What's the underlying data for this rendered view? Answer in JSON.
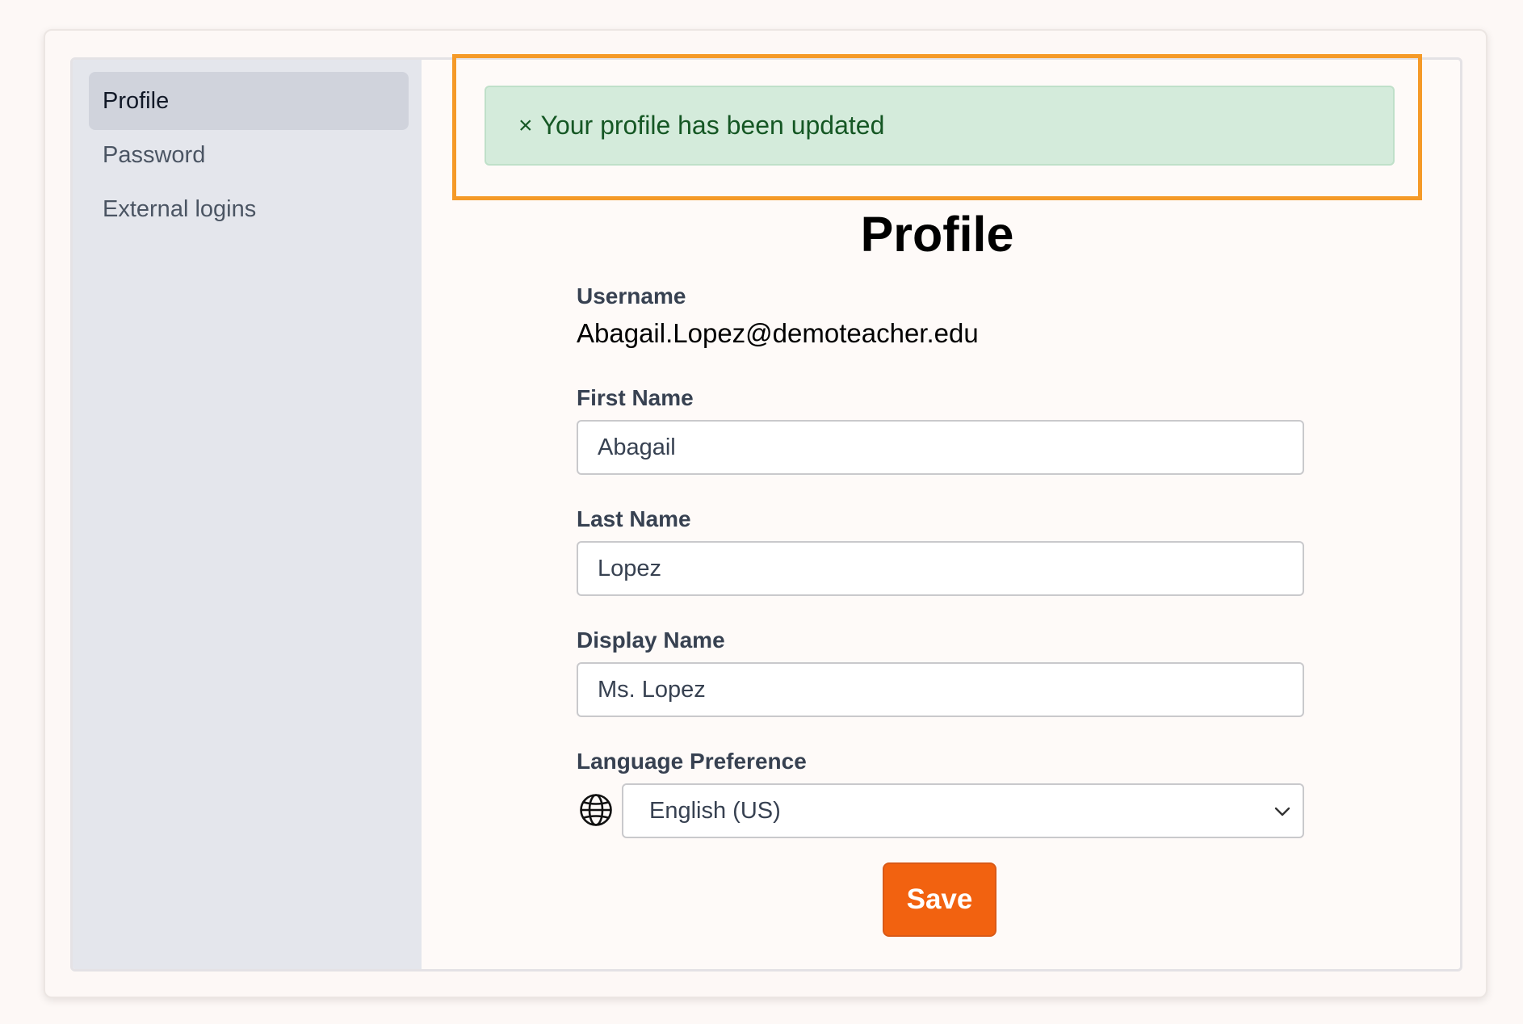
{
  "sidebar": {
    "items": [
      {
        "label": "Profile",
        "active": true
      },
      {
        "label": "Password",
        "active": false
      },
      {
        "label": "External logins",
        "active": false
      }
    ]
  },
  "alert": {
    "close_symbol": "×",
    "message": "Your profile has been updated",
    "color": "#155724",
    "background": "#d4ebdb"
  },
  "page": {
    "title": "Profile"
  },
  "form": {
    "username": {
      "label": "Username",
      "value": "Abagail.Lopez@demoteacher.edu"
    },
    "first_name": {
      "label": "First Name",
      "value": "Abagail"
    },
    "last_name": {
      "label": "Last Name",
      "value": "Lopez"
    },
    "display_name": {
      "label": "Display Name",
      "value": "Ms. Lopez"
    },
    "language": {
      "label": "Language Preference",
      "value": "English (US)",
      "icon": "globe-icon"
    },
    "save_label": "Save"
  },
  "colors": {
    "accent": "#f26210",
    "highlight": "#f59a28",
    "sidebar_bg": "#e4e6ec"
  }
}
